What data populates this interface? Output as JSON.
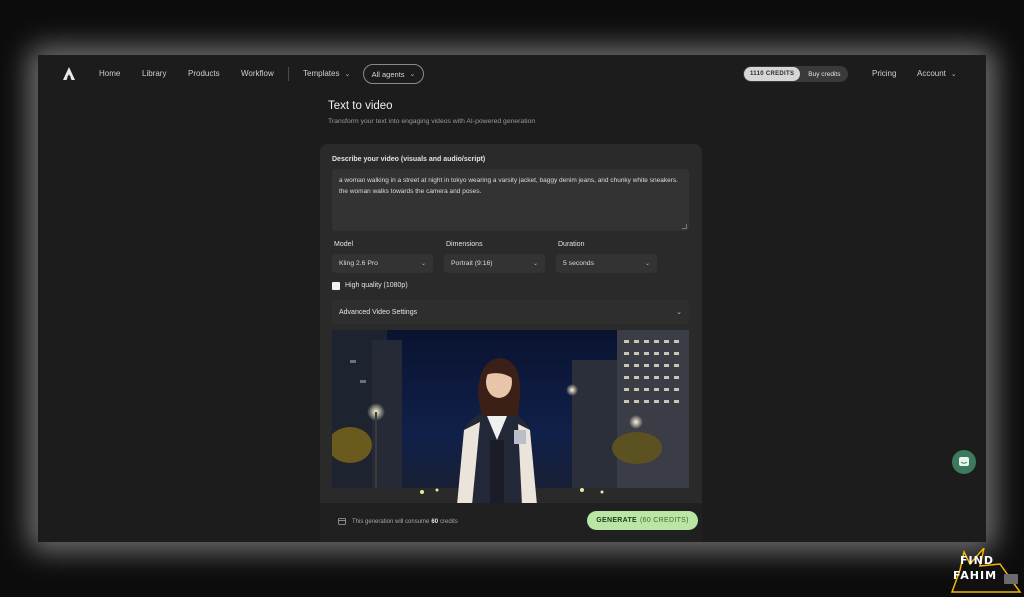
{
  "nav": {
    "items": [
      "Home",
      "Library",
      "Products",
      "Workflow"
    ],
    "templates": "Templates",
    "agents": "All agents",
    "credits": "1110 CREDITS",
    "buy_credits": "Buy credits",
    "pricing": "Pricing",
    "account": "Account"
  },
  "page": {
    "title": "Text to video",
    "subtitle": "Transform your text into engaging videos with AI-powered generation"
  },
  "form": {
    "prompt_label": "Describe your video (visuals and audio/script)",
    "prompt_value": "a woman walking in a street at night in tokyo wearing a varsity jacket, baggy denim jeans, and chunky white sneakers. the woman walks towards the camera and poses.",
    "model_label": "Model",
    "model_value": "Kling 2.6 Pro",
    "dimensions_label": "Dimensions",
    "dimensions_value": "Portrait (9:16)",
    "duration_label": "Duration",
    "duration_value": "5 seconds",
    "hq_label": "High quality (1080p)",
    "advanced_label": "Advanced Video Settings"
  },
  "footer": {
    "consume_prefix": "This generation will consume",
    "consume_amount": "60",
    "consume_suffix": "credits",
    "generate_label": "GENERATE",
    "generate_sub": "(60 CREDITS)"
  },
  "brand": {
    "line1": "FIND",
    "line2": "FAHIM"
  },
  "colors": {
    "generate": "#b9e6a4",
    "chat": "#3d7a5d"
  }
}
